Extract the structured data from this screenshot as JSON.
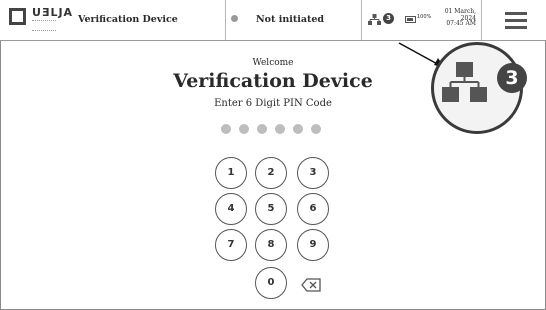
{
  "header": {
    "logo_text": "UƎLJA",
    "device_title": "Verification Device",
    "status_text": "Not initiated",
    "network_count": "3",
    "battery_text": "100%",
    "date": "01 March, 2024",
    "time": "07:45 AM"
  },
  "main": {
    "welcome": "Welcome",
    "title": "Verification Device",
    "pin_prompt": "Enter 6 Digit PIN Code",
    "pin_length": 6
  },
  "keypad": {
    "keys": [
      "1",
      "2",
      "3",
      "4",
      "5",
      "6",
      "7",
      "8",
      "9",
      "0"
    ]
  },
  "callout": {
    "network_count": "3"
  },
  "icons": {
    "menu": "hamburger-menu-icon",
    "network": "network-icon",
    "battery": "battery-icon",
    "backspace": "backspace-icon"
  }
}
